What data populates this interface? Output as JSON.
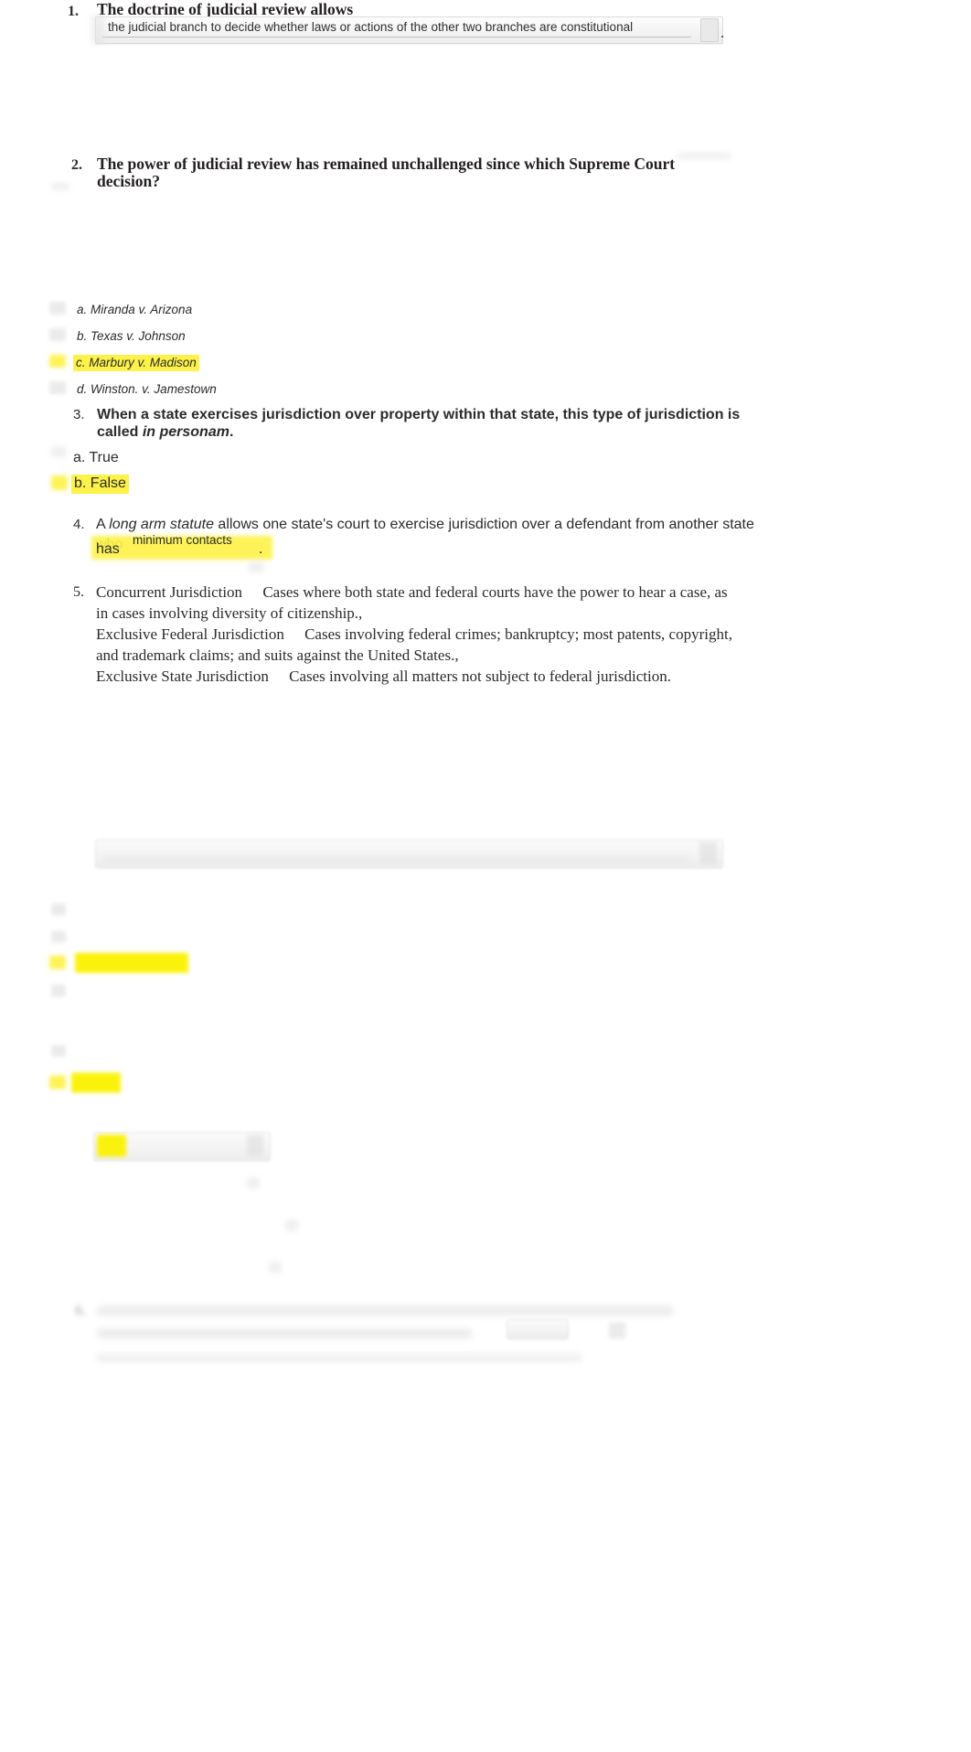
{
  "document": {
    "type": "quiz-worksheet",
    "highlight_color": "#fdf24a",
    "text_color": "#2b2b2b"
  },
  "questions": [
    {
      "number": "1.",
      "prompt": "The doctrine of judicial review allows",
      "answer_field_value": "the judicial branch to decide whether laws or actions of the other two branches are constitutional",
      "trailing_punctuation": "."
    },
    {
      "number": "2.",
      "prompt_line1": "The power of judicial review has remained unchallenged since which Supreme Court",
      "prompt_line2": "decision?",
      "options": [
        {
          "label": "a.",
          "text": "Miranda v. Arizona",
          "highlighted": false
        },
        {
          "label": "b.",
          "text": "Texas v. Johnson",
          "highlighted": false
        },
        {
          "label": "c.",
          "text": "Marbury v. Madison",
          "highlighted": true
        },
        {
          "label": "d.",
          "text": "Winston. v. Jamestown",
          "highlighted": false
        }
      ]
    },
    {
      "number": "3.",
      "prompt_line1": "When a state exercises jurisdiction over property within that state, this type of jurisdiction is",
      "prompt_line2_pre": "called ",
      "prompt_line2_italic": "in personam",
      "prompt_line2_post": ".",
      "options": [
        {
          "label": "a.",
          "text": "True",
          "highlighted": false
        },
        {
          "label": "b.",
          "text": "False",
          "highlighted": true
        }
      ]
    },
    {
      "number": "4.",
      "pre": "A ",
      "italic": "long arm statute",
      "post": " allows one state's court to exercise jurisdiction over a defendant from another state who",
      "line2_pre": "has",
      "line2_answer": "minimum contacts",
      "line2_post": "."
    },
    {
      "number": "5.",
      "matches": [
        {
          "term": "Concurrent Jurisdiction",
          "definition": "Cases where both state and federal courts have the power to hear a case, as in cases involving diversity of citizenship.,"
        },
        {
          "term": "Exclusive Federal Jurisdiction",
          "definition": "Cases involving federal crimes; bankruptcy; most patents, copyright, and trademark claims; and suits against the United States.,"
        },
        {
          "term": "Exclusive State Jurisdiction",
          "definition": "Cases involving all matters not subject to federal jurisdiction."
        }
      ]
    }
  ],
  "obscured_region": {
    "note": "lower portion of page is out of focus / blurred",
    "highlighted_blocks": 3
  }
}
